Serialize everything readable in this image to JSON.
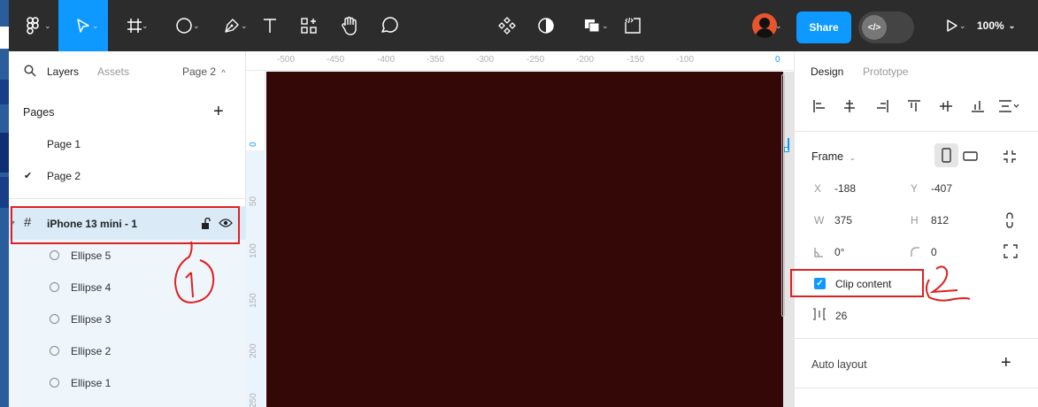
{
  "colors": {
    "toolbar_bg": "#2c2c2c",
    "accent": "#0d99ff",
    "frame_fill": "#350808",
    "canvas_bg": "#e5e5e5",
    "annotation_red": "#e02020",
    "selected_row_bg": "#daebf7",
    "child_row_bg": "#eef6fc"
  },
  "toolbar": {
    "tools": [
      {
        "name": "main-menu-icon"
      },
      {
        "name": "move-tool-icon"
      },
      {
        "name": "frame-tool-icon"
      },
      {
        "name": "shape-tool-icon"
      },
      {
        "name": "pen-tool-icon"
      },
      {
        "name": "text-tool-icon"
      },
      {
        "name": "resources-icon"
      },
      {
        "name": "hand-tool-icon"
      },
      {
        "name": "comment-tool-icon"
      },
      {
        "name": "component-icon"
      },
      {
        "name": "mask-icon"
      },
      {
        "name": "boolean-icon"
      },
      {
        "name": "devmode-icon"
      }
    ],
    "share_label": "Share",
    "dev_toggle_label": "</>",
    "zoom_label": "100%"
  },
  "left_panel": {
    "tabs": [
      "Layers",
      "Assets"
    ],
    "current_page": "Page 2",
    "pages_title": "Pages",
    "pages": [
      "Page 1",
      "Page 2"
    ],
    "selected_page_index": 1,
    "frame_layer": "iPhone 13 mini - 1",
    "child_layers": [
      "Ellipse 5",
      "Ellipse 4",
      "Ellipse 3",
      "Ellipse 2",
      "Ellipse 1"
    ]
  },
  "rulers": {
    "horizontal_ticks": [
      "-500",
      "-450",
      "-400",
      "-350",
      "-300",
      "-250",
      "-200",
      "-150",
      "-100"
    ],
    "horizontal_end": "0",
    "vertical_ticks": [
      "0",
      "50",
      "100",
      "150",
      "200",
      "250"
    ]
  },
  "right_panel": {
    "tabs": [
      "Design",
      "Prototype"
    ],
    "section_title": "Frame",
    "x_label": "X",
    "x_value": "-188",
    "y_label": "Y",
    "y_value": "-407",
    "w_label": "W",
    "w_value": "375",
    "h_label": "H",
    "h_value": "812",
    "rotation_value": "0°",
    "radius_value": "0",
    "clip_content_label": "Clip content",
    "clip_content_checked": true,
    "spacing_value": "26",
    "auto_layout_label": "Auto layout"
  },
  "annotations": [
    "1",
    "2"
  ]
}
